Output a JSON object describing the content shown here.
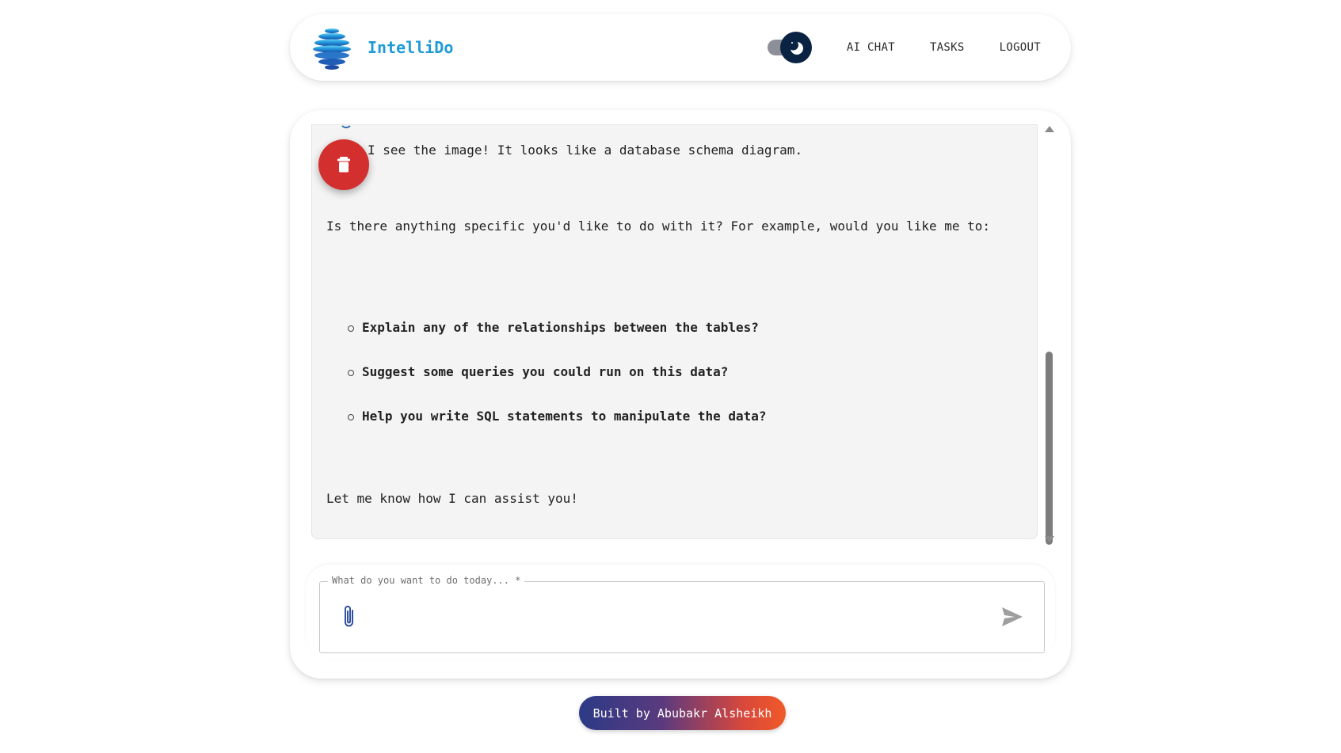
{
  "app": {
    "name": "IntelliDo",
    "brand_color": "#1e9bd7"
  },
  "nav": {
    "theme_toggle": {
      "icon": "moon-icon",
      "mode": "dark",
      "track_color": "#8c8f98",
      "thumb_color": "#0b2343"
    },
    "links": [
      "AI CHAT",
      "TASKS",
      "LOGOUT"
    ]
  },
  "chat": {
    "message": {
      "line1": "I see the image! It looks like a database schema diagram.",
      "line2": "Is there anything specific you'd like to do with it? For example, would you like me to:",
      "options": [
        "Explain any of the relationships between the tables?",
        "Suggest some queries you could run on this data?",
        "Help you write SQL statements to manipulate the data?"
      ],
      "closing": "Let me know how I can assist you!"
    },
    "delete_button": {
      "icon": "trash-icon",
      "color": "#d32f2f"
    },
    "scroll_position": 0.55
  },
  "input": {
    "label": "What do you want to do today... *",
    "value": "",
    "attach_icon": "paperclip-icon",
    "send_icon": "send-icon"
  },
  "footer": {
    "credit": "Built by Abubakr Alsheikh",
    "gradient": [
      "#2c3a86",
      "#f05a28"
    ]
  }
}
